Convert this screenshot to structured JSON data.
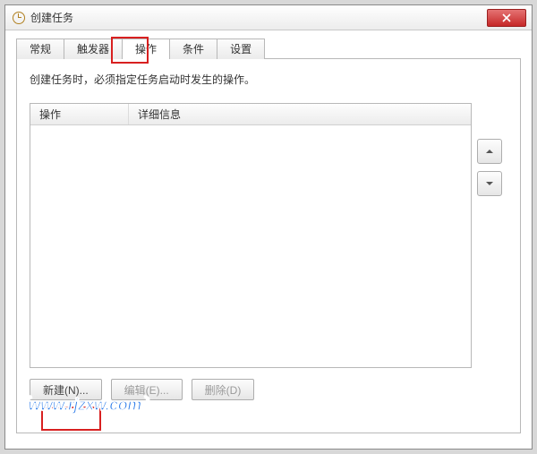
{
  "window": {
    "title": "创建任务"
  },
  "tabs": {
    "general": "常规",
    "triggers": "触发器",
    "actions": "操作",
    "conditions": "条件",
    "settings": "设置"
  },
  "panel": {
    "description": "创建任务时，必须指定任务启动时发生的操作。",
    "col_action": "操作",
    "col_details": "详细信息"
  },
  "buttons": {
    "new": "新建(N)...",
    "edit": "编辑(E)...",
    "delete": "删除(D)"
  },
  "watermark": "www.rjzxw.com"
}
